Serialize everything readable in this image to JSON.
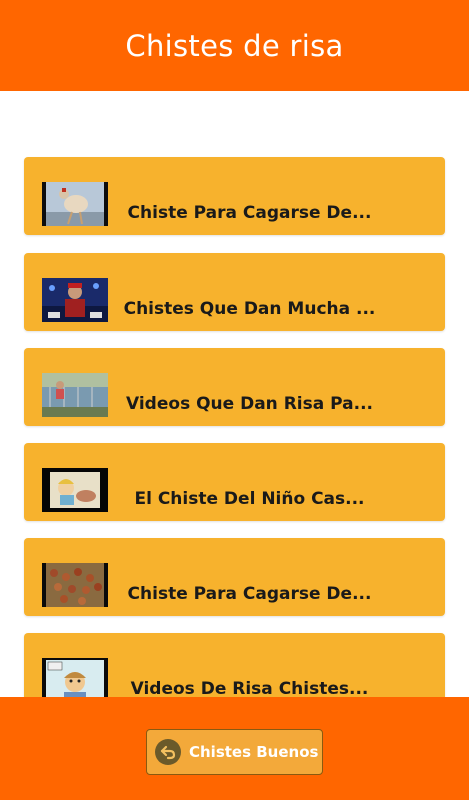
{
  "app": {
    "title": "Chistes de risa"
  },
  "videos": [
    {
      "title": "Chiste Para Cagarse De..."
    },
    {
      "title": "Chistes Que Dan Mucha ..."
    },
    {
      "title": "Videos Que Dan Risa Pa..."
    },
    {
      "title": "El Chiste Del Niño Cas..."
    },
    {
      "title": "Chiste Para Cagarse De..."
    },
    {
      "title": "Videos De Risa Chistes..."
    }
  ],
  "footer": {
    "button_label": "Chistes Buenos",
    "button_icon": "back-arrow-icon"
  },
  "colors": {
    "header": "#ff6600",
    "card": "#f7b22d",
    "footer": "#ff6600"
  }
}
